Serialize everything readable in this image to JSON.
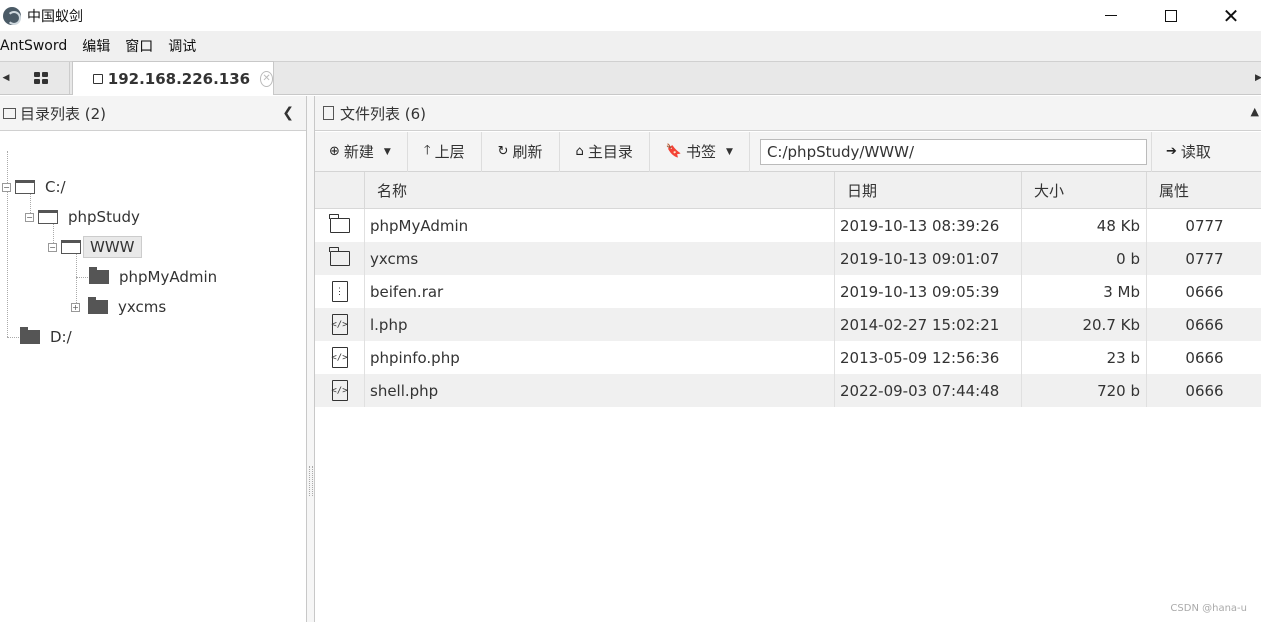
{
  "window": {
    "title": "中国蚁剑",
    "minimize_icon": "minimize-icon",
    "maximize_icon": "maximize-icon",
    "close_icon": "close-icon"
  },
  "menu": [
    "AntSword",
    "编辑",
    "窗口",
    "调试"
  ],
  "tabs": {
    "active_label": "192.168.226.136"
  },
  "left_panel": {
    "title": "目录列表 (2)",
    "tree": [
      {
        "label": "C:/"
      },
      {
        "label": "phpStudy"
      },
      {
        "label": "WWW"
      },
      {
        "label": "phpMyAdmin"
      },
      {
        "label": "yxcms"
      },
      {
        "label": "D:/"
      }
    ]
  },
  "right_panel": {
    "title": "文件列表 (6)",
    "toolbar": {
      "new_label": "新建",
      "up_label": "上层",
      "refresh_label": "刷新",
      "home_label": "主目录",
      "bookmark_label": "书签",
      "path_value": "C:/phpStudy/WWW/",
      "read_label": "读取"
    },
    "columns": {
      "name": "名称",
      "date": "日期",
      "size": "大小",
      "attr": "属性"
    },
    "files": [
      {
        "type": "folder",
        "name": "phpMyAdmin",
        "date": "2019-10-13 08:39:26",
        "size": "48 Kb",
        "attr": "0777"
      },
      {
        "type": "folder",
        "name": "yxcms",
        "date": "2019-10-13 09:01:07",
        "size": "0 b",
        "attr": "0777"
      },
      {
        "type": "archive",
        "name": "beifen.rar",
        "date": "2019-10-13 09:05:39",
        "size": "3 Mb",
        "attr": "0666"
      },
      {
        "type": "code",
        "name": "l.php",
        "date": "2014-02-27 15:02:21",
        "size": "20.7 Kb",
        "attr": "0666"
      },
      {
        "type": "code",
        "name": "phpinfo.php",
        "date": "2013-05-09 12:56:36",
        "size": "23 b",
        "attr": "0666"
      },
      {
        "type": "code",
        "name": "shell.php",
        "date": "2022-09-03 07:44:48",
        "size": "720 b",
        "attr": "0666"
      }
    ]
  },
  "watermark": "CSDN @hana-u"
}
